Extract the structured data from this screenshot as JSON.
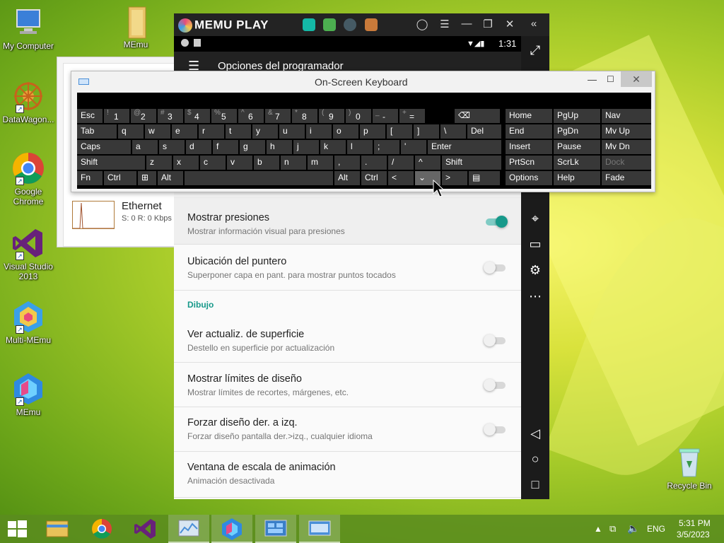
{
  "desktop": {
    "icons": [
      {
        "label": "My Computer"
      },
      {
        "label": "MEmu"
      },
      {
        "label": "DataWagon..."
      },
      {
        "label": "Google Chrome"
      },
      {
        "label": "Visual Studio 2013"
      },
      {
        "label": "Multi-MEmu"
      },
      {
        "label": "MEmu"
      },
      {
        "label": "Recycle Bin"
      }
    ]
  },
  "network_window": {
    "adapter_name": "Ethernet",
    "adapter_stats": "S: 0 R: 0 Kbps"
  },
  "memu": {
    "logo": "MEMU PLAY",
    "status_time": "1:31",
    "app_title": "Opciones del programador",
    "settings": [
      {
        "title": "Mostrar presiones",
        "subtitle": "Mostrar información visual para presiones",
        "on": true
      },
      {
        "title": "Ubicación del puntero",
        "subtitle": "Superponer capa en pant. para mostrar puntos tocados",
        "on": false
      },
      {
        "section": "Dibujo"
      },
      {
        "title": "Ver actualiz. de superficie",
        "subtitle": "Destello en superficie por actualización",
        "on": false
      },
      {
        "title": "Mostrar límites de diseño",
        "subtitle": "Mostrar límites de recortes, márgenes, etc.",
        "on": false
      },
      {
        "title": "Forzar diseño der. a izq.",
        "subtitle": "Forzar diseño pantalla der.>izq., cualquier idioma",
        "on": false
      },
      {
        "title": "Ventana de escala de animación",
        "subtitle": "Animación desactivada"
      }
    ]
  },
  "osk": {
    "title": "On-Screen Keyboard",
    "rows": [
      [
        "Esc",
        "1",
        "2",
        "3",
        "4",
        "5",
        "6",
        "7",
        "8",
        "9",
        "0",
        "-",
        "="
      ],
      [
        "Tab",
        "q",
        "w",
        "e",
        "r",
        "t",
        "y",
        "u",
        "i",
        "o",
        "p",
        "[",
        "]",
        "\\",
        "Del"
      ],
      [
        "Caps",
        "a",
        "s",
        "d",
        "f",
        "g",
        "h",
        "j",
        "k",
        "l",
        ";",
        "'",
        "Enter"
      ],
      [
        "Shift",
        "z",
        "x",
        "c",
        "v",
        "b",
        "n",
        "m",
        ",",
        ".",
        "/",
        "^",
        "Shift"
      ],
      [
        "Fn",
        "Ctrl",
        "Alt",
        "Alt",
        "Ctrl",
        "<",
        ">"
      ]
    ],
    "num_row_shift": [
      "~ `",
      "!",
      "@",
      "#",
      "$",
      "%",
      "^",
      "&",
      "*",
      "(",
      ")",
      "_",
      "+"
    ],
    "nav_keys": [
      [
        "Home",
        "PgUp",
        "Nav"
      ],
      [
        "End",
        "PgDn",
        "Mv Up"
      ],
      [
        "Insert",
        "Pause",
        "Mv Dn"
      ],
      [
        "PrtScn",
        "ScrLk",
        "Dock"
      ],
      [
        "Options",
        "Help",
        "Fade"
      ]
    ]
  },
  "taskbar": {
    "lang": "ENG",
    "time": "5:31 PM",
    "date": "3/5/2023"
  }
}
